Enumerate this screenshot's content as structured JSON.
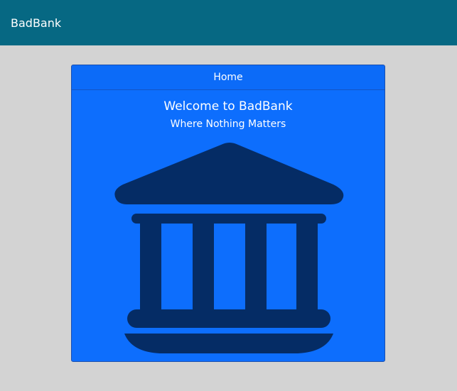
{
  "navbar": {
    "brand": "BadBank"
  },
  "card": {
    "header": "Home",
    "title": "Welcome to BadBank",
    "subtitle": "Where Nothing Matters",
    "image_icon": "bank-building-icon"
  },
  "colors": {
    "navbar_bg": "#066883",
    "page_bg": "#d3d3d3",
    "card_bg": "#0d6efd",
    "icon_fill": "#052c65",
    "text": "#ffffff"
  }
}
